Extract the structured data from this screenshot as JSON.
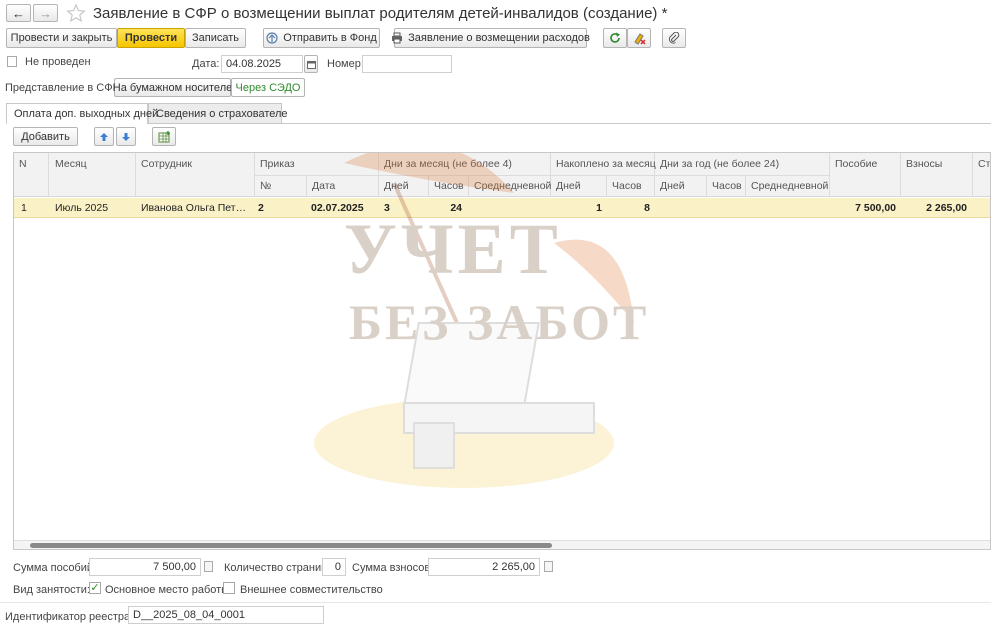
{
  "window": {
    "title": "Заявление в СФР о возмещении выплат родителям детей-инвалидов (создание) *",
    "back_icon": "←",
    "forward_icon": "→"
  },
  "toolbar": {
    "post_close": "Провести и закрыть",
    "post": "Провести",
    "save": "Записать",
    "send_fund": "Отправить в Фонд",
    "application": "Заявление о возмещении расходов"
  },
  "status": {
    "label": "Не проведен",
    "date_label": "Дата:",
    "date_value": "04.08.2025",
    "number_label": "Номер:",
    "number_value": ""
  },
  "submission": {
    "label": "Представление в СФР:",
    "paper": "На бумажном носителе",
    "sedo": "Через СЭДО"
  },
  "tabs": [
    {
      "label": "Оплата доп. выходных дней"
    },
    {
      "label": "Сведения о страхователе"
    }
  ],
  "table_toolbar": {
    "add": "Добавить"
  },
  "table": {
    "headers": {
      "n": "N",
      "month": "Месяц",
      "employee": "Сотрудник",
      "order": "Приказ",
      "order_no": "№",
      "order_date": "Дата",
      "days_month": "Дни за месяц (не более 4)",
      "dm_days": "Дней",
      "dm_hours": "Часов",
      "dm_avg": "Среднедневной",
      "accum_month": "Накоплено за месяц",
      "am_days": "Дней",
      "am_hours": "Часов",
      "days_year": "Дни за год (не более 24)",
      "dy_days": "Дней",
      "dy_hours": "Часов",
      "dy_avg": "Среднедневной",
      "benefit": "Пособие",
      "contrib": "Взносы",
      "more": "Ст"
    },
    "rows": [
      {
        "n": "1",
        "month": "Июль 2025",
        "employee": "Иванова Ольга Петровна",
        "order_no": "2",
        "order_date": "02.07.2025",
        "dm_days": "3",
        "dm_hours": "24",
        "dm_avg": "",
        "am_days": "1",
        "am_hours": "8",
        "dy_days": "",
        "dy_hours": "",
        "dy_avg": "",
        "benefit": "7 500,00",
        "contrib": "2 265,00"
      }
    ]
  },
  "watermark": {
    "line1": "УЧЕТ",
    "line2": "БЕЗ ЗАБОТ"
  },
  "footer": {
    "sum_benefits_label": "Сумма пособий:",
    "sum_benefits_value": "7 500,00",
    "pages_label": "Количество страниц:",
    "pages_value": "0",
    "sum_contrib_label": "Сумма взносов:",
    "sum_contrib_value": "2 265,00",
    "employment_label": "Вид занятости:",
    "main_job": "Основное место работы",
    "part_time": "Внешнее совместительство",
    "registry_label": "Идентификатор реестра:",
    "registry_value": "D__2025_08_04_0001"
  },
  "colors": {
    "primary_button": "#f5c500",
    "selected_row": "#fbf1c7",
    "sedo_text": "#2e8b2e",
    "watermark": "#c9a27a"
  }
}
